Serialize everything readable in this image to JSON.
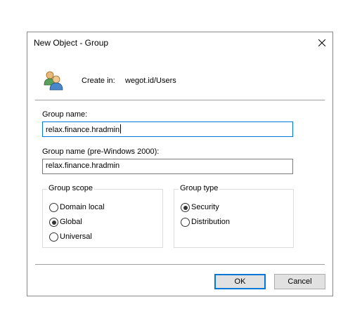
{
  "window": {
    "title": "New Object - Group"
  },
  "header": {
    "create_in_label": "Create in:",
    "create_in_value": "wegot.id/Users",
    "icon": "group-users-icon"
  },
  "form": {
    "group_name_label": "Group name:",
    "group_name_value": "relax.finance.hradmin",
    "pre2000_label": "Group name (pre-Windows 2000):",
    "pre2000_value": "relax.finance.hradmin"
  },
  "group_scope": {
    "legend": "Group scope",
    "options": [
      {
        "label": "Domain local",
        "checked": false
      },
      {
        "label": "Global",
        "checked": true
      },
      {
        "label": "Universal",
        "checked": false
      }
    ]
  },
  "group_type": {
    "legend": "Group type",
    "options": [
      {
        "label": "Security",
        "checked": true
      },
      {
        "label": "Distribution",
        "checked": false
      }
    ]
  },
  "buttons": {
    "ok": "OK",
    "cancel": "Cancel"
  },
  "colors": {
    "focus_border": "#0078d7",
    "dialog_background": "#f0f0f0"
  }
}
